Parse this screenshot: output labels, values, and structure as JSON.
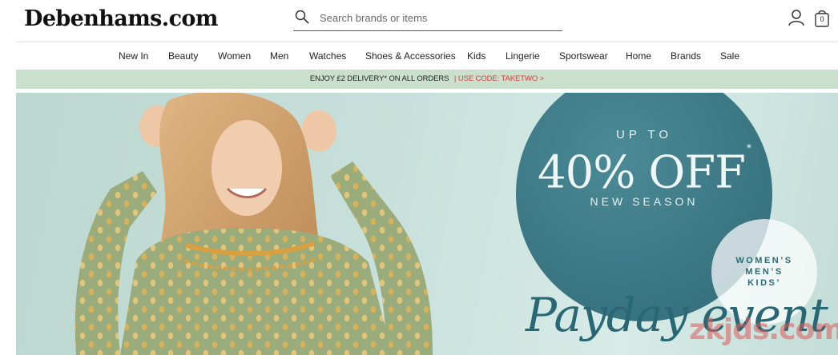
{
  "header": {
    "logo": "Debenhams.com",
    "search": {
      "placeholder": "Search brands or items",
      "icon": "search-icon"
    },
    "account_icon": "user-icon",
    "bag": {
      "icon": "shopping-bag-icon",
      "count": "0"
    }
  },
  "nav": {
    "items": [
      {
        "label": "New In"
      },
      {
        "label": "Beauty"
      },
      {
        "label": "Women"
      },
      {
        "label": "Men"
      },
      {
        "label": "Watches"
      },
      {
        "label": "Shoes & Accessories"
      },
      {
        "label": "Kids"
      },
      {
        "label": "Lingerie"
      },
      {
        "label": "Sportswear"
      },
      {
        "label": "Home"
      },
      {
        "label": "Brands"
      },
      {
        "label": "Sale"
      }
    ]
  },
  "promo": {
    "text": "ENJOY £2 DELIVERY* ON ALL ORDERS",
    "link": "| USE CODE: TAKETWO >",
    "background": "#c9e0cd",
    "link_color": "#d23c3c"
  },
  "hero": {
    "up_to": "UP TO",
    "discount": "40% OFF",
    "asterisk": "*",
    "subline": "NEW SEASON",
    "categories": [
      "WOMEN’S",
      "MEN’S",
      "KIDS’"
    ],
    "event": "Payday event",
    "accent": "#3b7683"
  },
  "watermark": "zkjds.com"
}
